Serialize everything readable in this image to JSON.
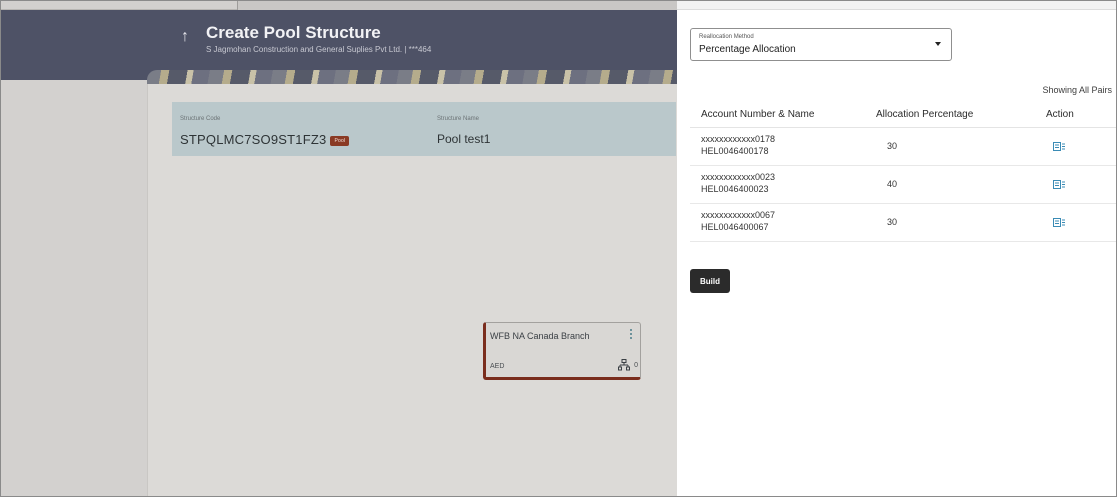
{
  "page": {
    "title": "Create Pool Structure",
    "subtitle": "S Jagmohan Construction and General Suplies Pvt Ltd. | ***464",
    "back_icon": "arrow-up-icon"
  },
  "structure": {
    "code_label": "Structure Code",
    "code_value": "STPQLMC7SO9ST1FZ3",
    "badge": "Pool",
    "name_label": "Structure Name",
    "name_value": "Pool test1"
  },
  "branch_card": {
    "name": "WFB NA Canada Branch",
    "currency": "AED",
    "count": "0",
    "menu_icon": "kebab-menu-icon",
    "hierarchy_icon": "hierarchy-icon"
  },
  "panel": {
    "reallocation_label": "Reallocation Method",
    "reallocation_value": "Percentage Allocation",
    "showing": "Showing All Pairs",
    "columns": [
      "Account Number & Name",
      "Allocation Percentage",
      "Action"
    ],
    "rows": [
      {
        "account": "xxxxxxxxxxxx0178",
        "name": "HEL0046400178",
        "percentage": "30"
      },
      {
        "account": "xxxxxxxxxxxx0023",
        "name": "HEL0046400023",
        "percentage": "40"
      },
      {
        "account": "xxxxxxxxxxxx0067",
        "name": "HEL0046400067",
        "percentage": "30"
      }
    ],
    "action_icon": "edit-details-icon",
    "build_label": "Build"
  },
  "colors": {
    "header_bg": "#4e5266",
    "badge_bg": "#8a3a24",
    "card_accent": "#7a2d1d",
    "action_icon": "#3a8bb5",
    "build_bg": "#2b2b2b"
  }
}
